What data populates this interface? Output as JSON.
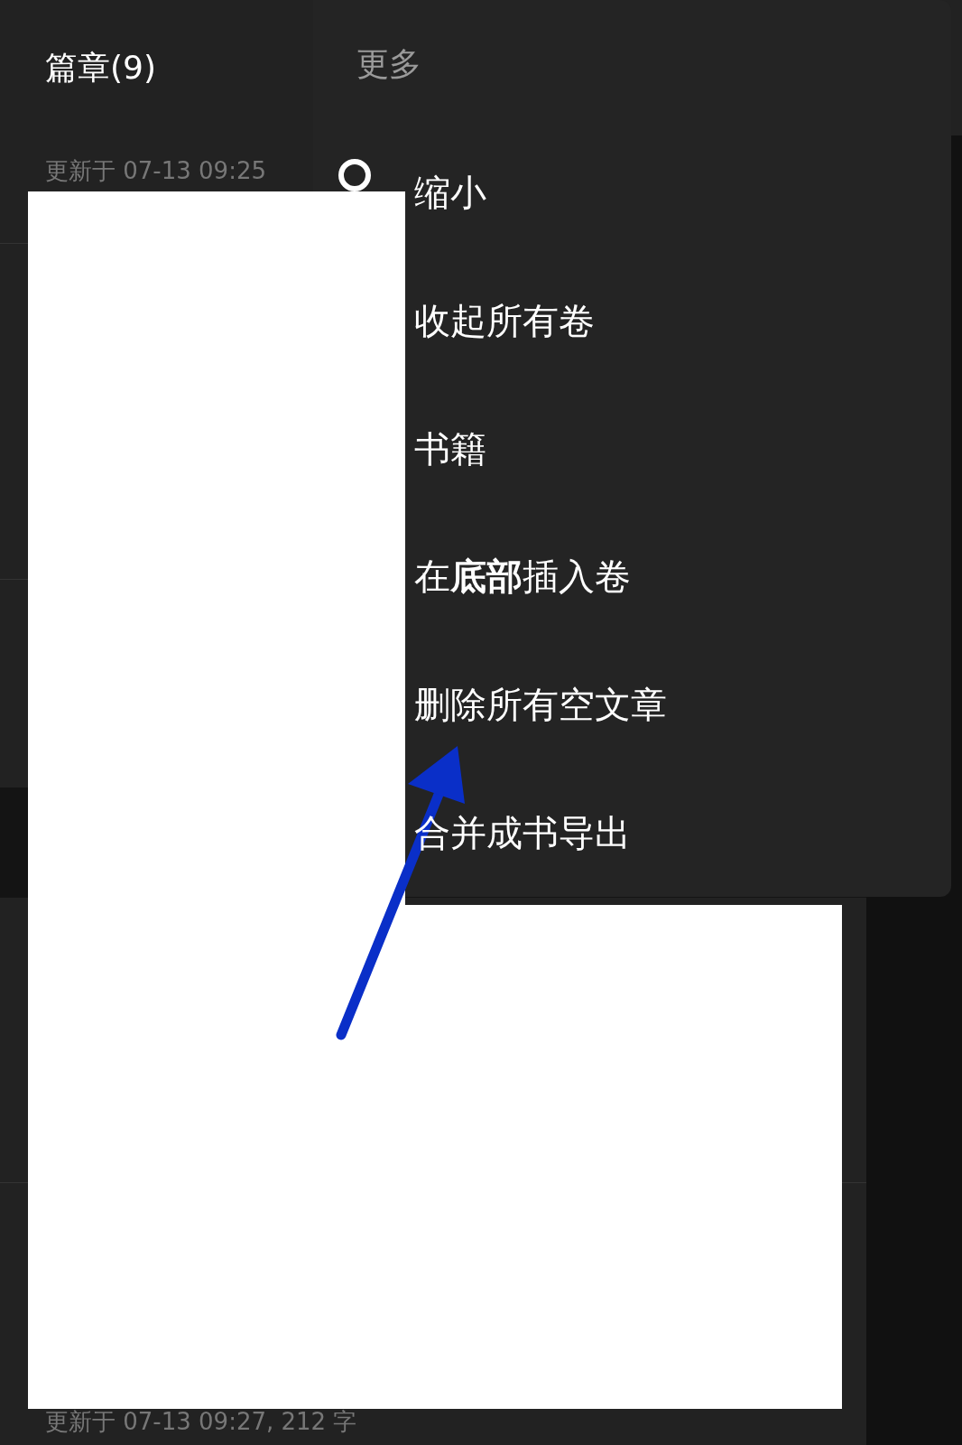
{
  "panel": {
    "title": "篇章(9)",
    "rows": [
      {
        "meta": "更新于 07-13 09:25"
      },
      {
        "meta": "更新于 07-13 09:27, 212 字"
      }
    ]
  },
  "menu": {
    "title": "更多",
    "items": [
      {
        "label": "缩小",
        "kind": "icon"
      },
      {
        "label": "收起所有卷",
        "kind": "text"
      },
      {
        "label": "书籍",
        "kind": "text"
      },
      {
        "label": "在**底部**插入卷",
        "kind": "text"
      },
      {
        "label": "删除所有空文章",
        "kind": "text"
      },
      {
        "label": "合并成书导出",
        "kind": "text"
      }
    ]
  }
}
